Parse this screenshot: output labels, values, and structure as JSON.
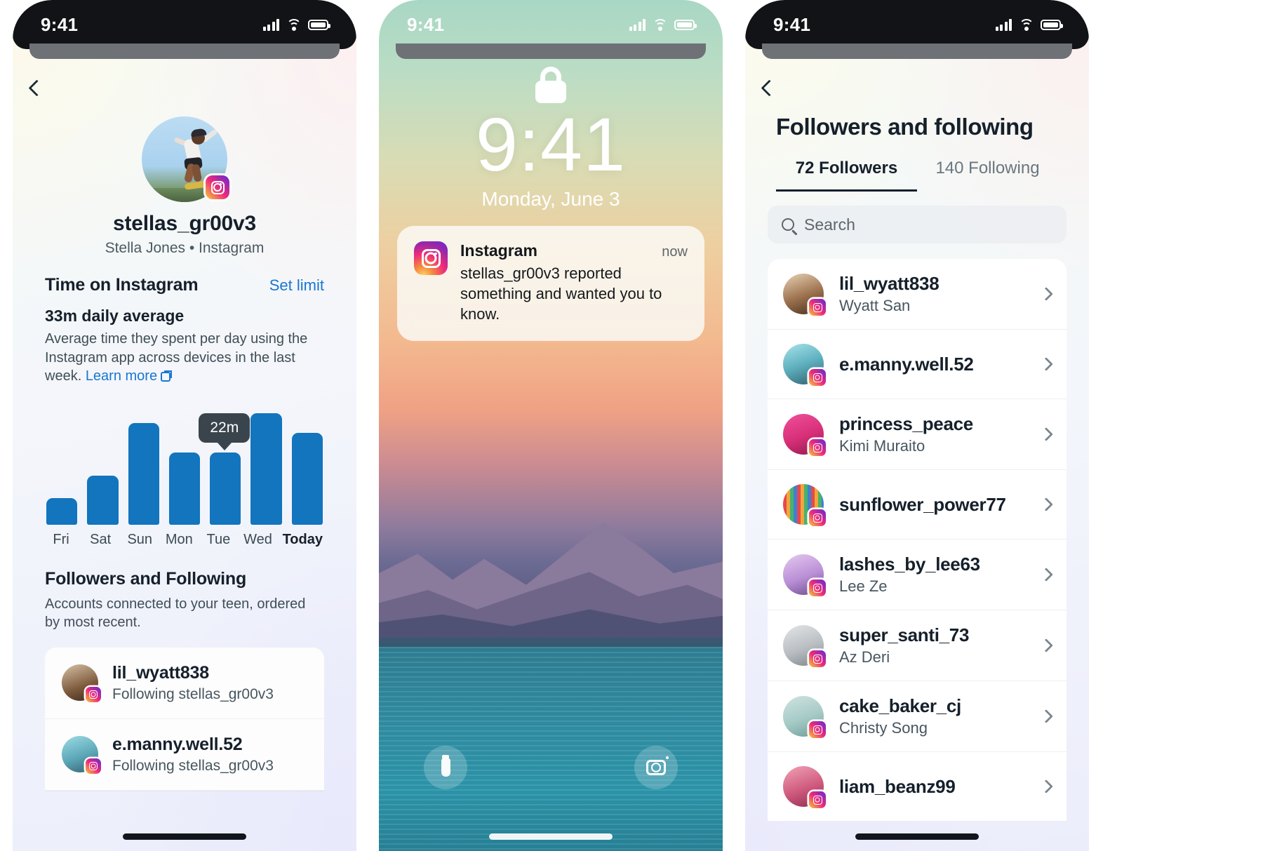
{
  "panels": {
    "supervision": {
      "status": {
        "time": "9:41"
      },
      "back_label": "Back",
      "profile": {
        "handle": "stellas_gr00v3",
        "subtitle": "Stella Jones • Instagram",
        "badge_icon": "instagram-icon"
      },
      "time_section": {
        "title": "Time on Instagram",
        "action": "Set limit",
        "headline": "33m daily average",
        "description": "Average time they spent per day using the Instagram app across devices in the last week.",
        "learn_more": "Learn more",
        "tooltip": "22m"
      },
      "followers_section": {
        "title": "Followers and Following",
        "description": "Accounts connected to your teen, ordered by most recent.",
        "rows": [
          {
            "name": "lil_wyatt838",
            "meta": "Following stellas_gr00v3"
          },
          {
            "name": "e.manny.well.52",
            "meta": "Following stellas_gr00v3"
          }
        ]
      }
    },
    "lockscreen": {
      "status": {
        "time": "9:41"
      },
      "lock_icon": "lock-icon",
      "clock": "9:41",
      "date": "Monday, June 3",
      "notification": {
        "app": "Instagram",
        "timestamp": "now",
        "text": "stellas_gr00v3 reported something and wanted you to know."
      },
      "buttons": {
        "left": "flashlight-icon",
        "right": "camera-icon"
      }
    },
    "followers": {
      "status": {
        "time": "9:41"
      },
      "title": "Followers and following",
      "tabs": [
        {
          "label": "72 Followers",
          "active": true
        },
        {
          "label": "140 Following",
          "active": false
        }
      ],
      "search_placeholder": "Search",
      "rows": [
        {
          "name": "lil_wyatt838",
          "real": "Wyatt San"
        },
        {
          "name": "e.manny.well.52",
          "real": ""
        },
        {
          "name": "princess_peace",
          "real": "Kimi Muraito"
        },
        {
          "name": "sunflower_power77",
          "real": ""
        },
        {
          "name": "lashes_by_lee63",
          "real": "Lee Ze"
        },
        {
          "name": "super_santi_73",
          "real": "Az Deri"
        },
        {
          "name": "cake_baker_cj",
          "real": "Christy Song"
        },
        {
          "name": "liam_beanz99",
          "real": ""
        }
      ]
    }
  },
  "chart_data": {
    "type": "bar",
    "title": "Time on Instagram",
    "subtitle": "33m daily average",
    "categories": [
      "Fri",
      "Sat",
      "Sun",
      "Mon",
      "Tue",
      "Wed",
      "Today"
    ],
    "values": [
      8,
      15,
      31,
      22,
      22,
      34,
      28
    ],
    "unit": "m",
    "highlighted_category": "Tue",
    "highlighted_label": "22m",
    "xlabel": "",
    "ylabel": "",
    "ylim": [
      0,
      36
    ],
    "grid": false,
    "legend": "none",
    "bar_color": "#1275bd"
  },
  "colors": {
    "accent_blue": "#1877d2",
    "bar_blue": "#1275bd",
    "text_dark": "#15202b",
    "text_muted": "#47565f",
    "tooltip_bg": "#3a444c"
  }
}
